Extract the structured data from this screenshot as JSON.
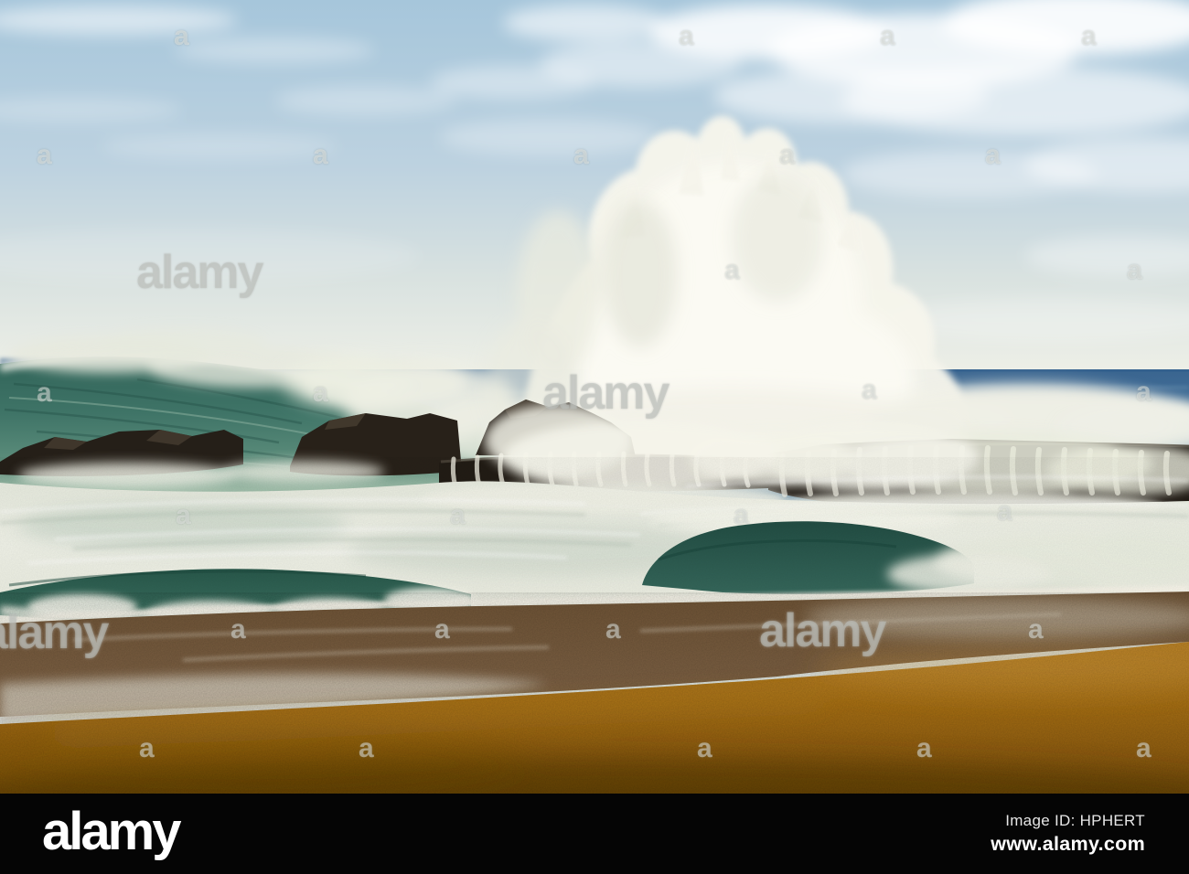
{
  "photo": {
    "alt": "Huge white wave splash exploding over dark lava rocks, teal breaking wave on the left, foamy surf and a golden sand beach in the foreground under a pale blue sky with wispy clouds"
  },
  "watermark": {
    "tile_letter": "a",
    "brand": "alamy"
  },
  "footer": {
    "brand": "alamy",
    "image_id_label": "Image ID:",
    "image_id_value": "HPHERT",
    "website": "www.alamy.com"
  },
  "colors": {
    "bar-bg": "#050505",
    "bar-text": "#ffffff",
    "bar-subtext": "#e6e6e6",
    "sky-blue": "#a6c6db",
    "ocean-blue": "#4a779f",
    "wave-teal": "#3f7467",
    "rock-dark": "#241e17",
    "foam-white": "#f2f2e8",
    "sand-gold": "#a87014"
  }
}
